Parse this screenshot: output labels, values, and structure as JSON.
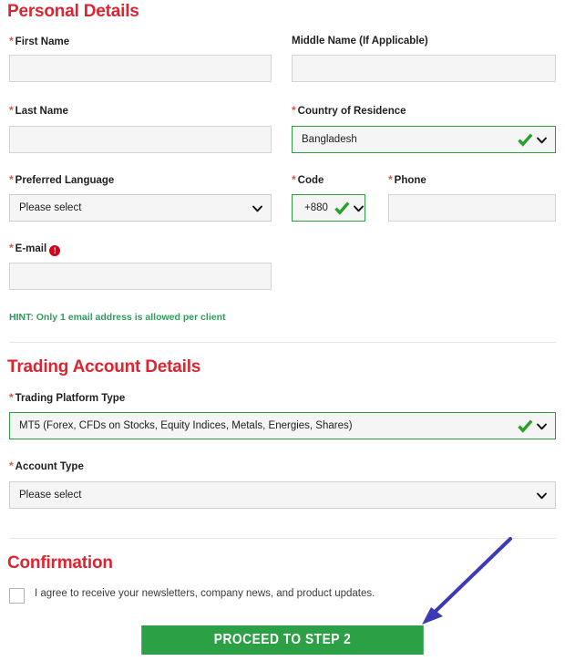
{
  "sections": {
    "personal": {
      "title": "Personal Details"
    },
    "trading": {
      "title": "Trading Account Details"
    },
    "confirmation": {
      "title": "Confirmation"
    }
  },
  "fields": {
    "first_name": {
      "label": "First Name",
      "required": true,
      "value": "",
      "placeholder": ""
    },
    "middle_name": {
      "label": "Middle Name (If Applicable)",
      "required": false,
      "value": "",
      "placeholder": ""
    },
    "last_name": {
      "label": "Last Name",
      "required": true,
      "value": "",
      "placeholder": ""
    },
    "country": {
      "label": "Country of Residence",
      "required": true,
      "value": "Bangladesh",
      "valid": true
    },
    "preferred_language": {
      "label": "Preferred Language",
      "required": true,
      "value": "Please select",
      "valid": false
    },
    "code": {
      "label": "Code",
      "required": true,
      "value": "+880",
      "valid": true
    },
    "phone": {
      "label": "Phone",
      "required": true,
      "value": "",
      "placeholder": ""
    },
    "email": {
      "label": "E-mail",
      "required": true,
      "value": "",
      "placeholder": "",
      "info_icon": "exclamation-circle-icon"
    },
    "trading_platform": {
      "label": "Trading Platform Type",
      "required": true,
      "value": "MT5 (Forex, CFDs on Stocks, Equity Indices, Metals, Energies, Shares)",
      "valid": true
    },
    "account_type": {
      "label": "Account Type",
      "required": true,
      "value": "Please select",
      "valid": false
    }
  },
  "hint": {
    "text": "HINT: Only 1 email address is allowed per client"
  },
  "newsletter": {
    "label": "I agree to receive your newsletters, company news, and product updates.",
    "checked": false
  },
  "submit": {
    "label": "Proceed to Step 2"
  },
  "required_marker": "*",
  "icons": {
    "valid_check": "green-check-icon",
    "dropdown": "chevron-down-icon",
    "annotation": "blue-arrow-annotation"
  },
  "colors": {
    "heading_red": "#dd2531",
    "valid_green": "#2e9c41",
    "button_green": "#2ba045",
    "hint_green": "#2f9c5c",
    "required_red": "#e8503a",
    "annotation_blue": "#3b3bb5",
    "field_bg": "#f5f5f5"
  }
}
